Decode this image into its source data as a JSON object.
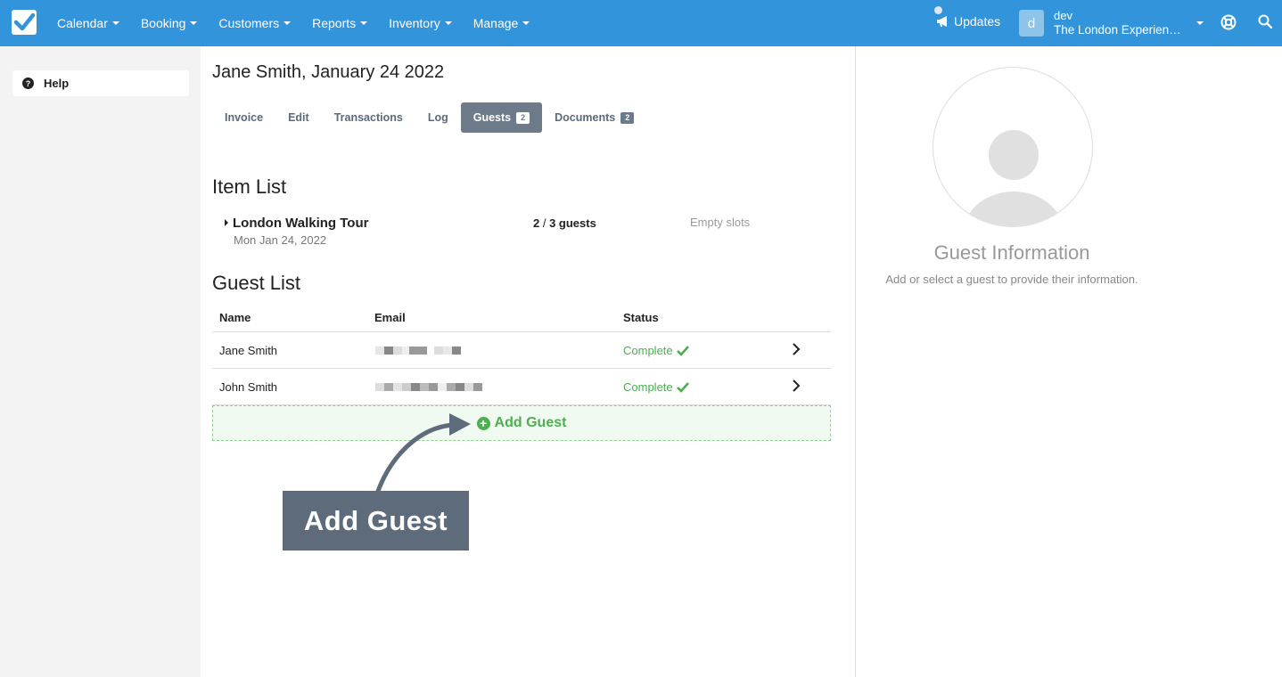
{
  "nav": {
    "items": [
      "Calendar",
      "Booking",
      "Customers",
      "Reports",
      "Inventory",
      "Manage"
    ],
    "updates_label": "Updates",
    "user_initial": "d",
    "user_name": "dev",
    "org_name": "The London Experience Co."
  },
  "sidebar": {
    "help_label": "Help"
  },
  "page": {
    "title": "Jane Smith, January 24 2022",
    "tabs": [
      {
        "label": "Invoice"
      },
      {
        "label": "Edit"
      },
      {
        "label": "Transactions"
      },
      {
        "label": "Log"
      },
      {
        "label": "Guests",
        "badge": "2",
        "active": true
      },
      {
        "label": "Documents",
        "badge": "2"
      }
    ]
  },
  "item_list": {
    "heading": "Item List",
    "item": {
      "name": "London Walking Tour",
      "date": "Mon Jan 24, 2022",
      "count_bold": "2",
      "count_sep": " / ",
      "count_rest": "3 guests",
      "slots": "Empty slots"
    }
  },
  "guest_list": {
    "heading": "Guest List",
    "columns": [
      "Name",
      "Email",
      "Status"
    ],
    "rows": [
      {
        "name": "Jane Smith",
        "status": "Complete"
      },
      {
        "name": "John Smith",
        "status": "Complete"
      }
    ],
    "add_label": "Add Guest"
  },
  "callout": {
    "label": "Add Guest"
  },
  "guest_info": {
    "title": "Guest Information",
    "subtitle": "Add or select a guest to provide their information."
  },
  "colors": {
    "nav_bg": "#3295dc",
    "status_green": "#4caf50",
    "tab_active": "#6c7a8a"
  }
}
